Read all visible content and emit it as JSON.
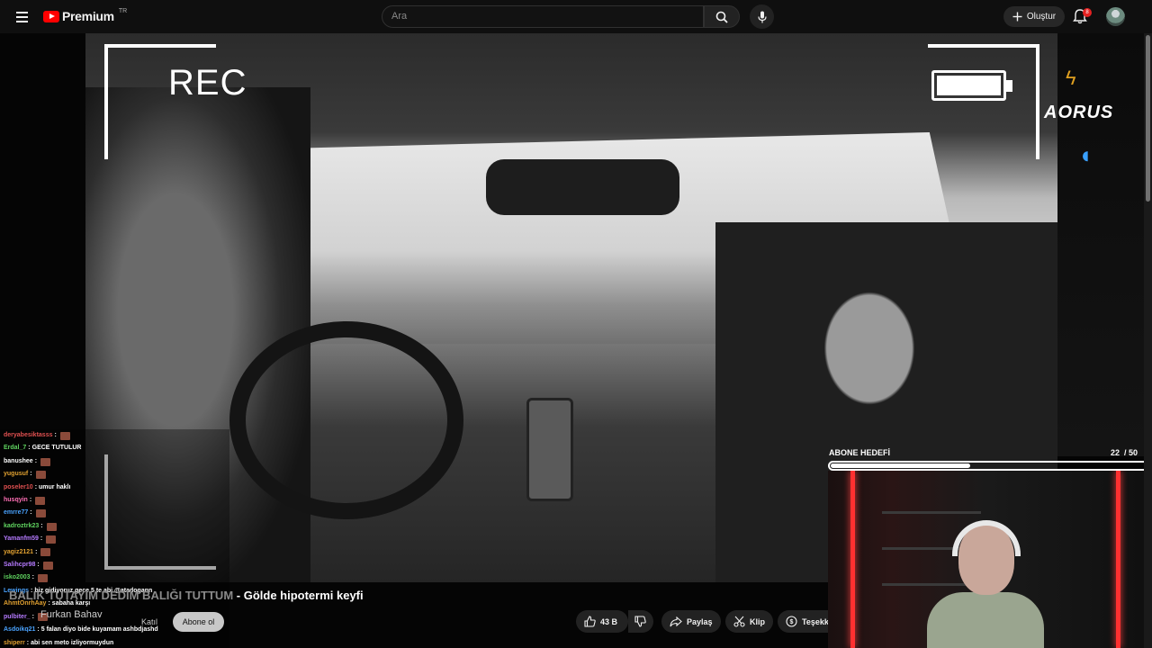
{
  "header": {
    "logo_text": "Premium",
    "country_code": "TR",
    "search_placeholder": "Ara",
    "create_label": "Oluştur",
    "notification_count": "8"
  },
  "overlay": {
    "rec_label": "REC",
    "brand_text": "AORUS",
    "goal_label": "ABONE HEDEFİ",
    "goal_current": "22",
    "goal_target": "/ 50",
    "goal_fraction": 0.44
  },
  "chat": [
    {
      "user": "deryabesiktasss",
      "text": "",
      "color": "#e05050",
      "emote": true
    },
    {
      "user": "Erdal_7",
      "text": "GECE TUTULUR",
      "color": "#5fd35f",
      "emote": false
    },
    {
      "user": "banushee",
      "text": "",
      "color": "#ffffff",
      "emote": true
    },
    {
      "user": "yugusuf",
      "text": "",
      "color": "#e0a030",
      "emote": true
    },
    {
      "user": "poseler10",
      "text": "umur haklı",
      "color": "#e05050",
      "emote": false
    },
    {
      "user": "husqyin",
      "text": "",
      "color": "#ff6fb5",
      "emote": true
    },
    {
      "user": "emrre77",
      "text": "",
      "color": "#4aa3ff",
      "emote": true
    },
    {
      "user": "kadroztrk23",
      "text": "",
      "color": "#5fd35f",
      "emote": true
    },
    {
      "user": "Yamanfm59",
      "text": "",
      "color": "#b57aff",
      "emote": true
    },
    {
      "user": "yagiz2121",
      "text": "",
      "color": "#e0a030",
      "emote": true
    },
    {
      "user": "Salihcpr98",
      "text": "",
      "color": "#b57aff",
      "emote": true
    },
    {
      "user": "isko2003",
      "text": "",
      "color": "#5fd35f",
      "emote": true
    },
    {
      "user": "Lewings",
      "text": "biz gidiyoruz gece 5 te abi @atadogann",
      "color": "#4aa3ff",
      "emote": false
    },
    {
      "user": "AhmtOnrhAay",
      "text": "sabaha karşı",
      "color": "#e0a030",
      "emote": false
    },
    {
      "user": "pulbiter_",
      "text": "",
      "color": "#b57aff",
      "emote": true
    },
    {
      "user": "Asdoikq21",
      "text": "5 falan diyo bide kuyamam ashbdjashd",
      "color": "#4aa3ff",
      "emote": false
    },
    {
      "user": "shiperr",
      "text": "abi sen meto izliyormuydun",
      "color": "#e0a030",
      "emote": false
    }
  ],
  "video": {
    "title_faded": "BALIK TUTAYIM DEDİM BALIĞI TUTTUM",
    "title_main": " - Gölde hipotermi keyfi",
    "channel": "Furkan Bahav",
    "join_label": "Katıl",
    "subscribe_label": "Abone ol",
    "likes": "43 B",
    "share_label": "Paylaş",
    "clip_label": "Klip",
    "thanks_label": "Teşekk"
  },
  "colors": {
    "youtube_red": "#ff0000",
    "background": "#0f0f0f",
    "neon": "#ff3030"
  }
}
